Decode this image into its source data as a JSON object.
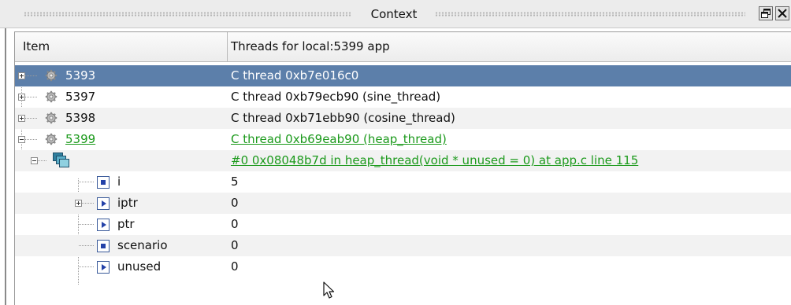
{
  "window": {
    "title": "Context"
  },
  "columns": {
    "item": "Item",
    "threads": "Threads for local:5399 app"
  },
  "rows": [
    {
      "item": "5393",
      "value": "C thread 0xb7e016c0"
    },
    {
      "item": "5397",
      "value": "C thread 0xb79ecb90 (sine_thread)"
    },
    {
      "item": "5398",
      "value": "C thread 0xb71ebb90 (cosine_thread)"
    },
    {
      "item": "5399",
      "value": "C thread 0xb69eab90 (heap_thread)"
    },
    {
      "item": "",
      "value": "#0 0x08048b7d in heap_thread(void * unused = 0) at app.c line 115"
    },
    {
      "item": "i",
      "value": "5"
    },
    {
      "item": "iptr",
      "value": "0"
    },
    {
      "item": "ptr",
      "value": "0"
    },
    {
      "item": "scenario",
      "value": "0"
    },
    {
      "item": "unused",
      "value": "0"
    }
  ],
  "icons": {
    "thread": "gear-icon",
    "frame": "stack-frames-icon",
    "scalar_var": "scalar-variable-icon",
    "pointer_var": "pointer-variable-icon",
    "float": "float-window-icon",
    "close": "close-icon"
  },
  "colors": {
    "selection": "#5c7faa",
    "current_thread": "#1c9a1c",
    "alternate_row": "#f2f2f2"
  }
}
